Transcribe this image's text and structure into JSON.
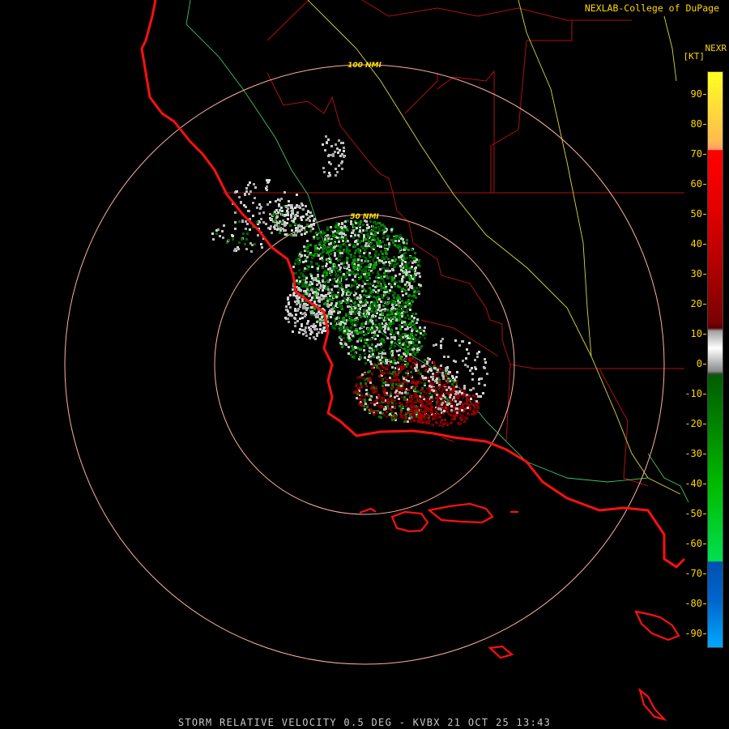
{
  "credit": "NEXLAB-College of DuPage",
  "product": "NEXR",
  "units": "[KT]",
  "footer": "STORM RELATIVE VELOCITY 0.5 DEG - KVBX 21 OCT 25 13:43",
  "range_rings": [
    "50 NMI",
    "100 NMI"
  ],
  "legend": {
    "labels": [
      "90",
      "80",
      "70",
      "60",
      "50",
      "40",
      "30",
      "20",
      "10",
      "0",
      "-10",
      "-20",
      "-30",
      "-40",
      "-50",
      "-60",
      "-70",
      "-80",
      "-90"
    ]
  },
  "colors": {
    "text": "#ffd700",
    "coastline": "#ff1010",
    "borders": "#b01010",
    "rings": "#ffb0a0",
    "roads_yellow": "#d8d840",
    "roads_green": "#40c060",
    "inbound_green": "#00a000",
    "outbound_red": "#b00000",
    "near_zero_gray": "#c0c0c0"
  }
}
